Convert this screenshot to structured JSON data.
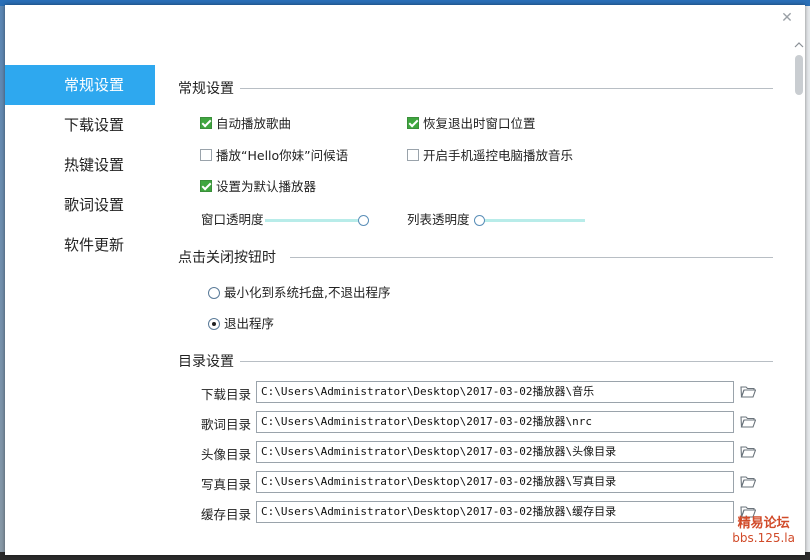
{
  "dialog": {
    "close_glyph": "✕"
  },
  "sidebar": {
    "items": [
      {
        "label": "常规设置",
        "active": true
      },
      {
        "label": "下载设置",
        "active": false
      },
      {
        "label": "热键设置",
        "active": false
      },
      {
        "label": "歌词设置",
        "active": false
      },
      {
        "label": "软件更新",
        "active": false
      }
    ]
  },
  "general": {
    "title": "常规设置",
    "auto_play": {
      "label": "自动播放歌曲",
      "checked": true
    },
    "restore_position": {
      "label": "恢复退出时窗口位置",
      "checked": true
    },
    "play_greeting": {
      "label": "播放“Hello你妹”问候语",
      "checked": false
    },
    "phone_remote": {
      "label": "开启手机遥控电脑播放音乐",
      "checked": false
    },
    "default_player": {
      "label": "设置为默认播放器",
      "checked": true
    },
    "window_opacity": {
      "label": "窗口透明度",
      "value": 1.0
    },
    "list_opacity": {
      "label": "列表透明度",
      "value": 0.0
    }
  },
  "close_behavior": {
    "title": "点击关闭按钮时",
    "minimize": {
      "label": "最小化到系统托盘,不退出程序",
      "selected": false
    },
    "exit": {
      "label": "退出程序",
      "selected": true
    }
  },
  "directories": {
    "title": "目录设置",
    "rows": [
      {
        "label": "下载目录",
        "value": "C:\\Users\\Administrator\\Desktop\\2017-03-02播放器\\音乐"
      },
      {
        "label": "歌词目录",
        "value": "C:\\Users\\Administrator\\Desktop\\2017-03-02播放器\\nrc"
      },
      {
        "label": "头像目录",
        "value": "C:\\Users\\Administrator\\Desktop\\2017-03-02播放器\\头像目录"
      },
      {
        "label": "写真目录",
        "value": "C:\\Users\\Administrator\\Desktop\\2017-03-02播放器\\写真目录"
      },
      {
        "label": "缓存目录",
        "value": "C:\\Users\\Administrator\\Desktop\\2017-03-02播放器\\缓存目录"
      }
    ]
  },
  "watermark": {
    "line1": "精易论坛",
    "line2": "bbs.125.la"
  },
  "colors": {
    "accent": "#2ea8ef",
    "check_green": "#3fa63f",
    "slider_track": "#b8ece9"
  }
}
